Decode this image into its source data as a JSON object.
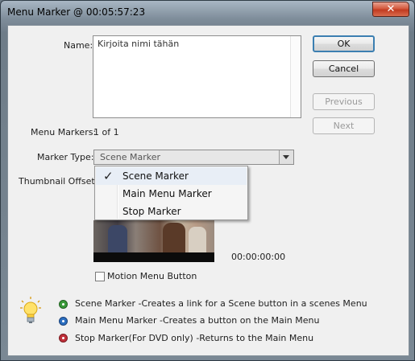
{
  "window": {
    "title": "Menu Marker @ 00:05:57:23",
    "close_glyph": "✕"
  },
  "form": {
    "name_label": "Name:",
    "name_value": "Kirjoita nimi tähän",
    "menu_markers_label": "Menu Markers:",
    "menu_markers_value": "1 of 1",
    "marker_type_label": "Marker Type:",
    "marker_type_value": "Scene Marker",
    "thumbnail_offset_label": "Thumbnail Offset:",
    "timecode": "00:00:00:00",
    "motion_menu_label": "Motion Menu Button",
    "motion_menu_checked": false
  },
  "buttons": {
    "ok": "OK",
    "cancel": "Cancel",
    "previous": "Previous",
    "next": "Next"
  },
  "dropdown_menu": {
    "items": [
      "Scene Marker",
      "Main Menu Marker",
      "Stop Marker"
    ],
    "selected": "Scene Marker",
    "check_glyph": "✓"
  },
  "legend": [
    {
      "text": "Scene Marker -Creates a link for a Scene button in a scenes Menu",
      "icon": "green-marker-icon",
      "color": "#3a9a3a"
    },
    {
      "text": "Main Menu Marker -Creates a button on the Main Menu",
      "icon": "blue-marker-icon",
      "color": "#2c6fc0"
    },
    {
      "text": "Stop Marker(For DVD only)  -Returns to the Main Menu",
      "icon": "red-marker-icon",
      "color": "#c0303a"
    }
  ],
  "colors": {
    "default_button_border": "#3c7fb1",
    "close_button": "#c13b20"
  }
}
